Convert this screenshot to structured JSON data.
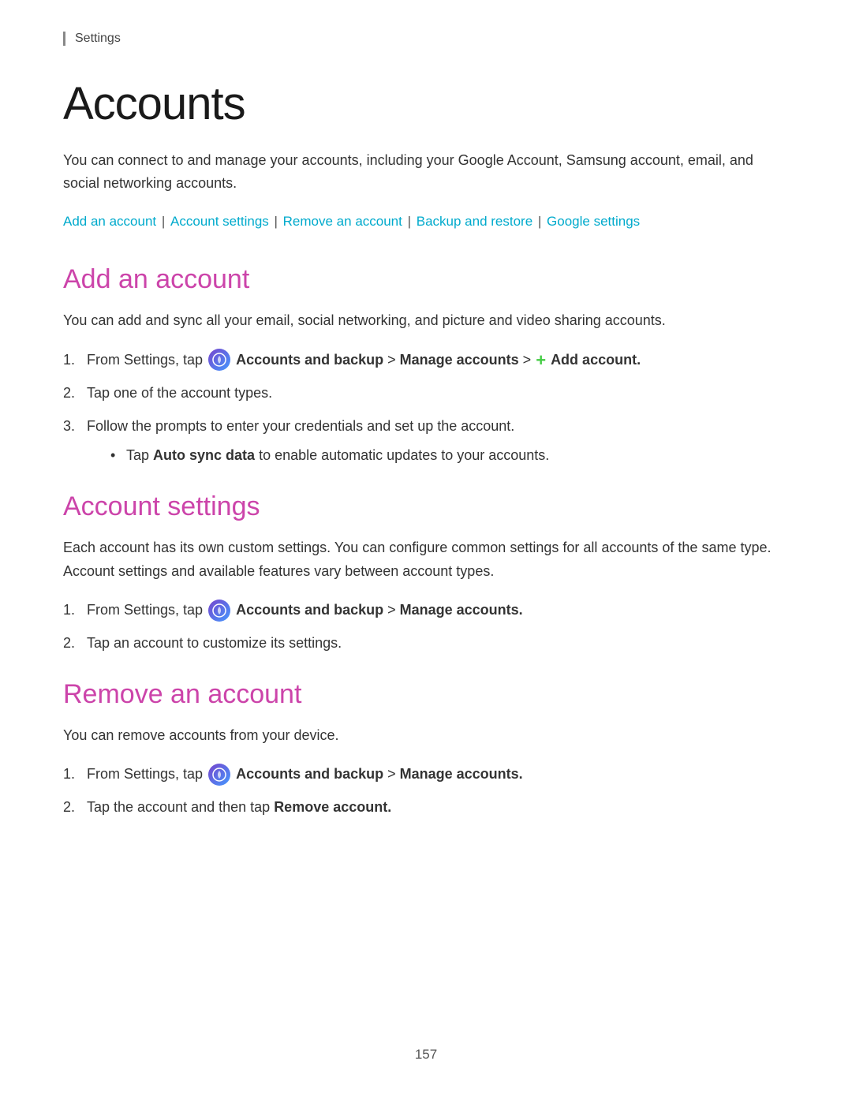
{
  "breadcrumb": "Settings",
  "page_title": "Accounts",
  "intro_text": "You can connect to and manage your accounts, including your Google Account, Samsung account, email, and social networking accounts.",
  "nav_links": [
    {
      "label": "Add an account",
      "href": "#add"
    },
    {
      "label": "Account settings",
      "href": "#account-settings"
    },
    {
      "label": "Remove an account",
      "href": "#remove"
    },
    {
      "label": "Backup and restore",
      "href": "#backup"
    },
    {
      "label": "Google settings",
      "href": "#google"
    }
  ],
  "sections": [
    {
      "id": "add",
      "title": "Add an account",
      "intro": "You can add and sync all your email, social networking, and picture and video sharing accounts.",
      "steps": [
        {
          "text_parts": [
            "From Settings, tap ",
            "icon",
            " Accounts and backup > Manage accounts > ",
            "plus",
            " Add account."
          ],
          "has_icon": true,
          "has_plus": true
        },
        {
          "text_parts": [
            "Tap one of the account types."
          ],
          "has_icon": false
        },
        {
          "text_parts": [
            "Follow the prompts to enter your credentials and set up the account."
          ],
          "has_icon": false,
          "bullet": "Tap Auto sync data to enable automatic updates to your accounts."
        }
      ]
    },
    {
      "id": "account-settings",
      "title": "Account settings",
      "intro": "Each account has its own custom settings. You can configure common settings for all accounts of the same type. Account settings and available features vary between account types.",
      "steps": [
        {
          "text_parts": [
            "From Settings, tap ",
            "icon",
            " Accounts and backup > Manage accounts."
          ],
          "has_icon": true
        },
        {
          "text_parts": [
            "Tap an account to customize its settings."
          ],
          "has_icon": false
        }
      ]
    },
    {
      "id": "remove",
      "title": "Remove an account",
      "intro": "You can remove accounts from your device.",
      "steps": [
        {
          "text_parts": [
            "From Settings, tap ",
            "icon",
            " Accounts and backup > Manage accounts."
          ],
          "has_icon": true
        },
        {
          "text_parts": [
            "Tap the account and then tap ",
            "bold:Remove account",
            "."
          ],
          "has_icon": false
        }
      ]
    }
  ],
  "page_number": "157",
  "colors": {
    "link": "#00aacc",
    "section_title": "#cc44aa",
    "accent_icon": "#6644cc",
    "plus_green": "#44cc44"
  }
}
